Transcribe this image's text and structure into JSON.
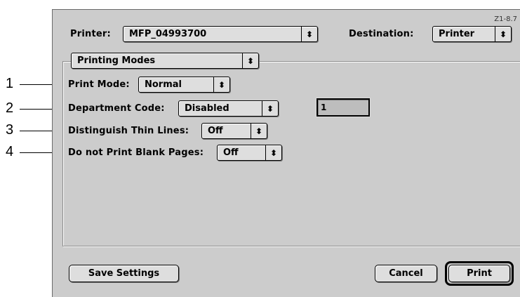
{
  "dialog": {
    "ref_code": "Z1-8.7",
    "printer_label": "Printer:",
    "printer_value": "MFP_04993700",
    "destination_label": "Destination:",
    "destination_value": "Printer",
    "section_value": "Printing Modes"
  },
  "settings": {
    "print_mode": {
      "label": "Print Mode:",
      "value": "Normal"
    },
    "department_code": {
      "label": "Department Code:",
      "value": "Disabled",
      "field_value": "1"
    },
    "thin_lines": {
      "label": "Distinguish Thin Lines:",
      "value": "Off"
    },
    "blank_pages": {
      "label": "Do not Print Blank Pages:",
      "value": "Off"
    }
  },
  "buttons": {
    "save_settings": "Save Settings",
    "cancel": "Cancel",
    "print": "Print"
  },
  "callouts": [
    "1",
    "2",
    "3",
    "4"
  ],
  "icons": {
    "popup_arrow": "up-down-arrows-icon",
    "arrow_glyph": "⬍"
  }
}
